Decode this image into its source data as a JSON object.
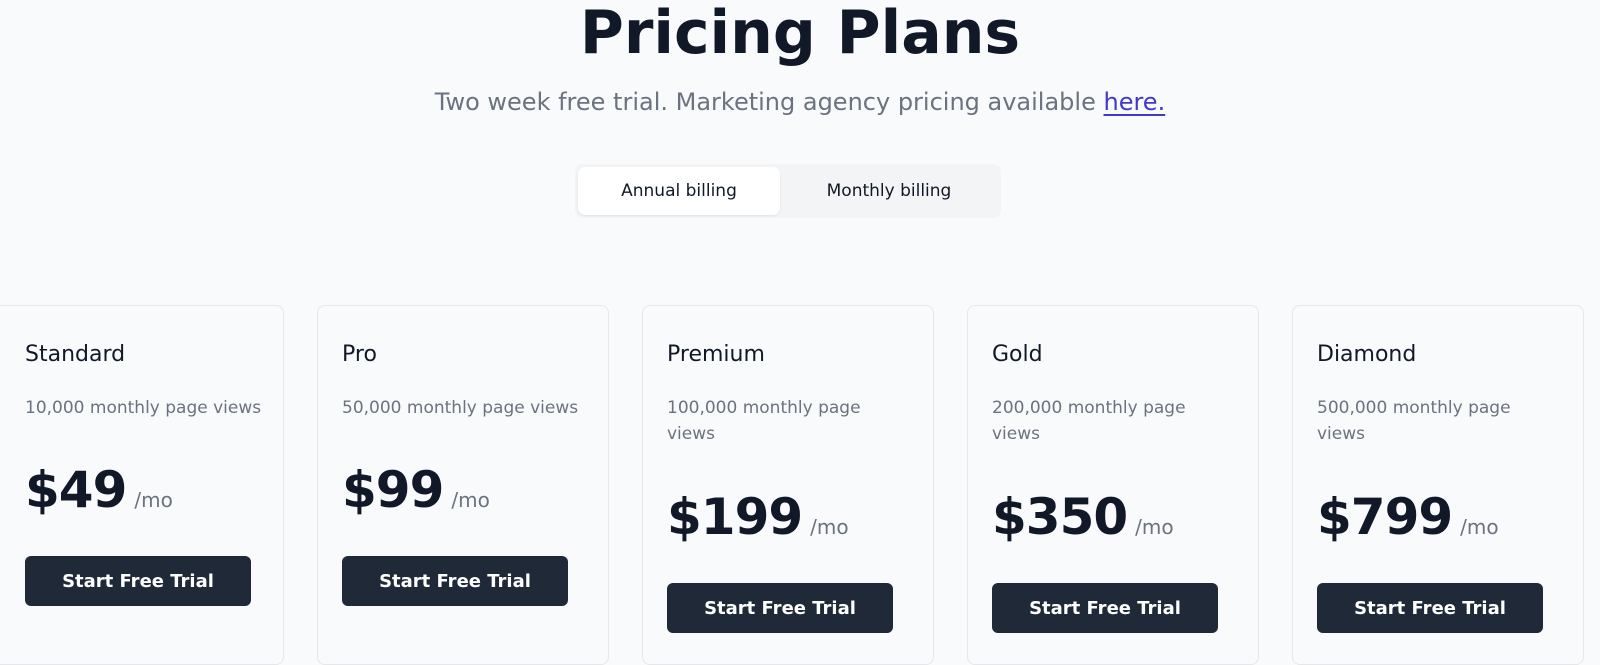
{
  "header": {
    "title": "Pricing Plans",
    "subtitle": "Two week free trial. Marketing agency pricing available ",
    "subtitle_link": "here."
  },
  "billing_toggle": {
    "options": [
      {
        "label": "Annual billing",
        "selected": true
      },
      {
        "label": "Monthly billing",
        "selected": false
      }
    ]
  },
  "plans": [
    {
      "name": "Standard",
      "description": "10,000 monthly page views",
      "price": "$49",
      "period": "/mo",
      "cta": "Start Free Trial"
    },
    {
      "name": "Pro",
      "description": "50,000 monthly page views",
      "price": "$99",
      "period": "/mo",
      "cta": "Start Free Trial"
    },
    {
      "name": "Premium",
      "description": "100,000 monthly page views",
      "price": "$199",
      "period": "/mo",
      "cta": "Start Free Trial"
    },
    {
      "name": "Gold",
      "description": "200,000 monthly page views",
      "price": "$350",
      "period": "/mo",
      "cta": "Start Free Trial"
    },
    {
      "name": "Diamond",
      "description": "500,000 monthly page views",
      "price": "$799",
      "period": "/mo",
      "cta": "Start Free Trial"
    }
  ]
}
